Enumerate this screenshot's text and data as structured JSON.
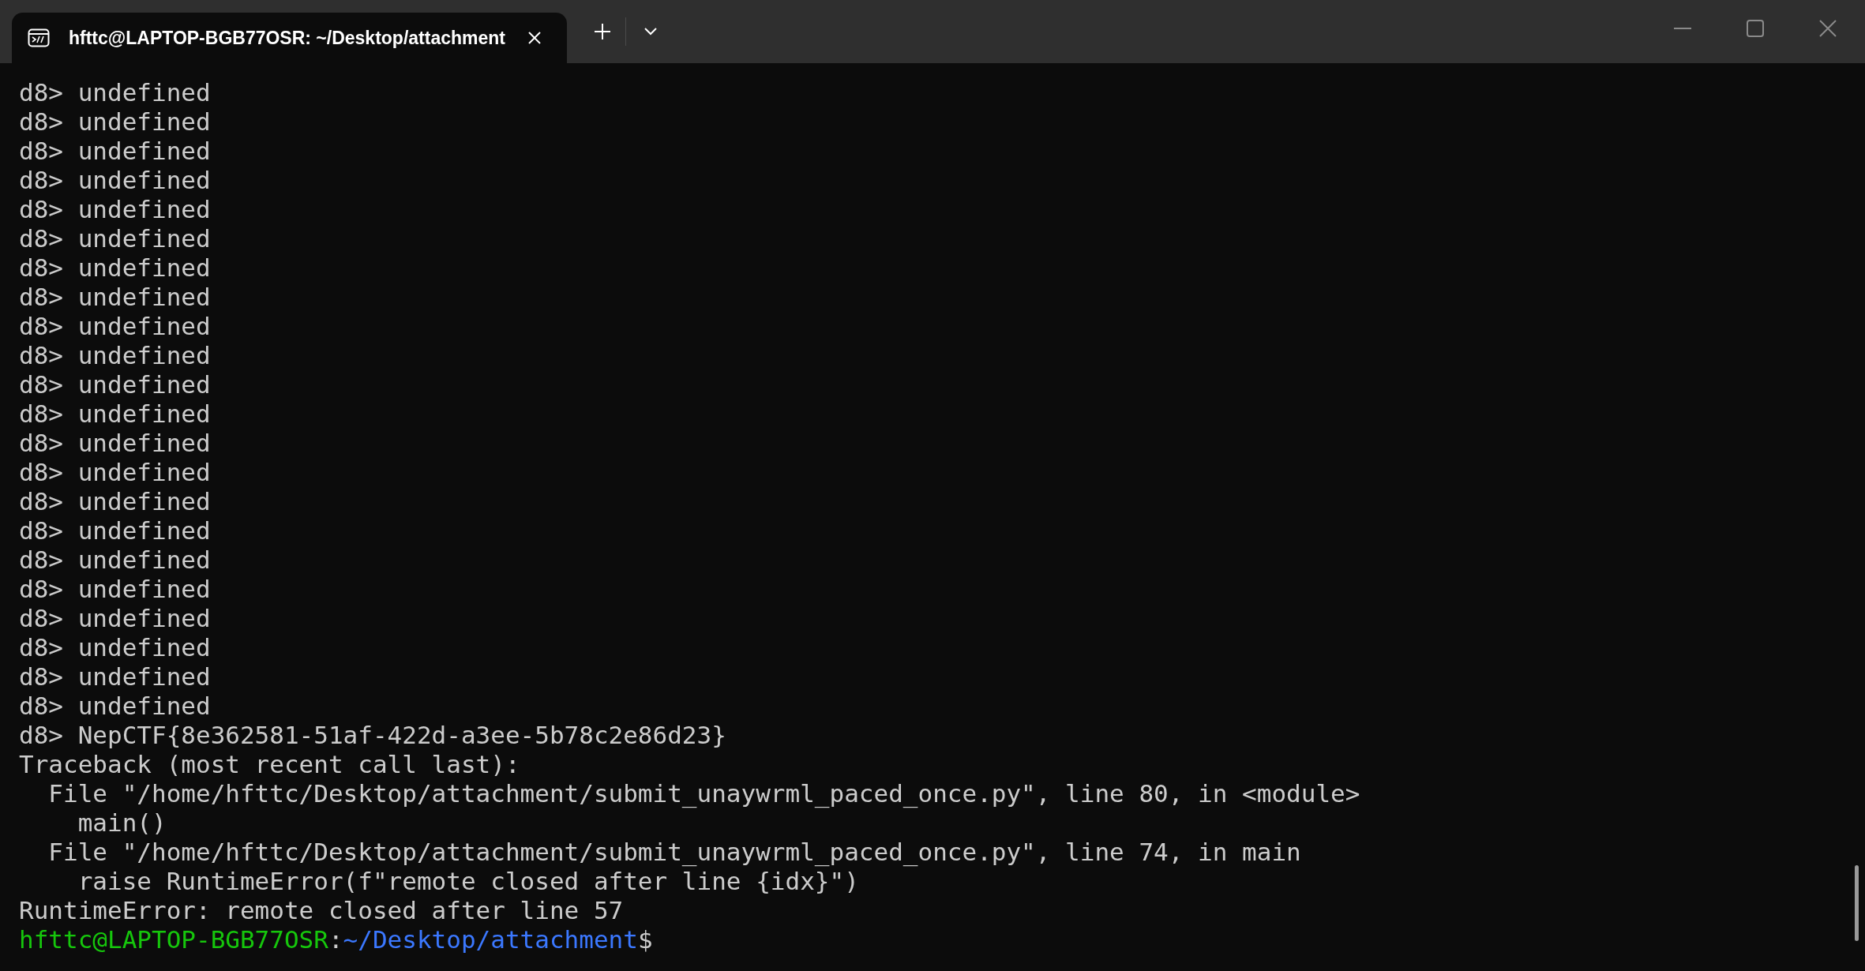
{
  "tabs": [
    {
      "title": "hfttc@LAPTOP-BGB77OSR: ~/Desktop/attachment",
      "selected": true
    }
  ],
  "terminal": {
    "lines": [
      {
        "text": "d8> undefined"
      },
      {
        "text": "d8> undefined"
      },
      {
        "text": "d8> undefined"
      },
      {
        "text": "d8> undefined"
      },
      {
        "text": "d8> undefined"
      },
      {
        "text": "d8> undefined"
      },
      {
        "text": "d8> undefined"
      },
      {
        "text": "d8> undefined"
      },
      {
        "text": "d8> undefined"
      },
      {
        "text": "d8> undefined"
      },
      {
        "text": "d8> undefined"
      },
      {
        "text": "d8> undefined"
      },
      {
        "text": "d8> undefined"
      },
      {
        "text": "d8> undefined"
      },
      {
        "text": "d8> undefined"
      },
      {
        "text": "d8> undefined"
      },
      {
        "text": "d8> undefined"
      },
      {
        "text": "d8> undefined"
      },
      {
        "text": "d8> undefined"
      },
      {
        "text": "d8> undefined"
      },
      {
        "text": "d8> undefined"
      },
      {
        "text": "d8> undefined"
      },
      {
        "text": "d8> NepCTF{8e362581-51af-422d-a3ee-5b78c2e86d23}"
      },
      {
        "text": "Traceback (most recent call last):"
      },
      {
        "text": "  File \"/home/hfttc/Desktop/attachment/submit_unaywrml_paced_once.py\", line 80, in <module>"
      },
      {
        "text": "    main()"
      },
      {
        "text": "  File \"/home/hfttc/Desktop/attachment/submit_unaywrml_paced_once.py\", line 74, in main"
      },
      {
        "text": "    raise RuntimeError(f\"remote closed after line {idx}\")"
      },
      {
        "text": "RuntimeError: remote closed after line 57"
      }
    ],
    "prompt": {
      "user_host": "hfttc@LAPTOP-BGB77OSR",
      "separator": ":",
      "path": "~/Desktop/attachment",
      "symbol": "$"
    }
  }
}
